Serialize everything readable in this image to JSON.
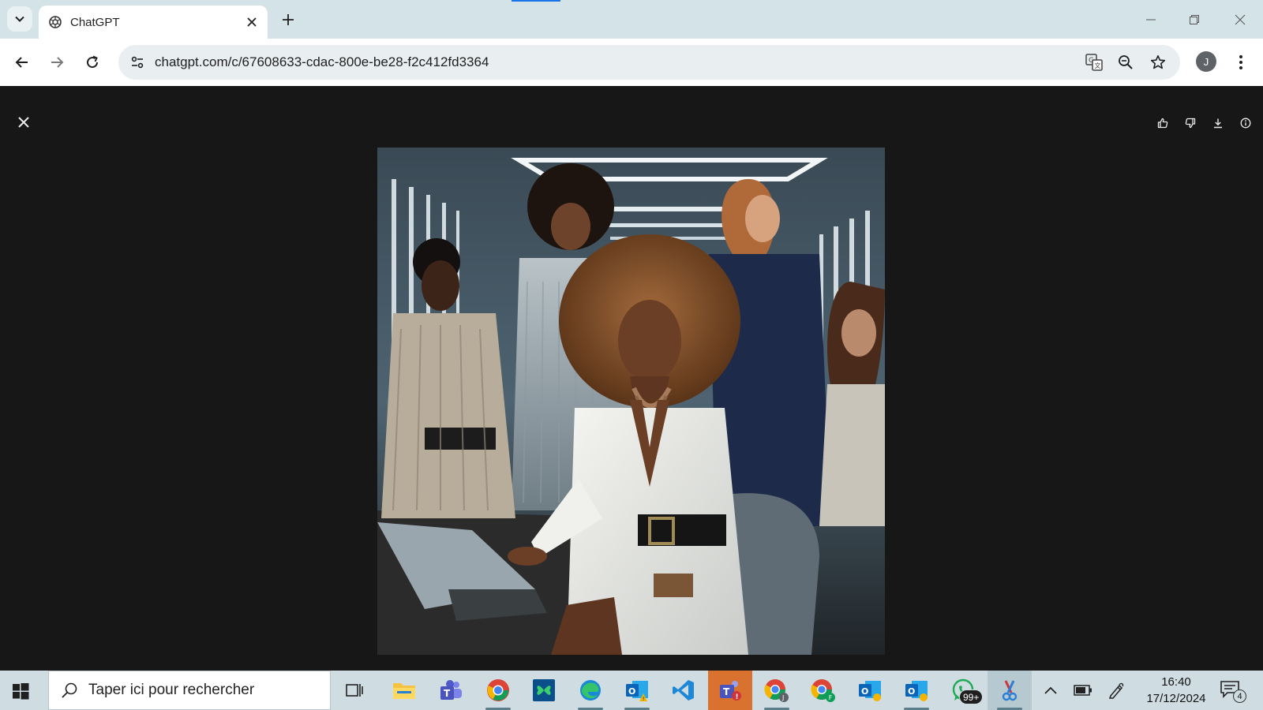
{
  "browser": {
    "tab_title": "ChatGPT",
    "url": "chatgpt.com/c/67608633-cdac-800e-be28-f2c412fd3364",
    "profile_initial": "J"
  },
  "viewer": {
    "actions": [
      "thumbs-up-icon",
      "thumbs-down-icon",
      "download-icon",
      "info-icon"
    ],
    "image_alt": "Generated image"
  },
  "taskbar": {
    "search_placeholder": "Taper ici pour rechercher",
    "whatsapp_badge": "99+",
    "time": "16:40",
    "date": "17/12/2024",
    "notification_count": "4",
    "colors": {
      "accent_active": "#d9722e",
      "background": "#cfdde3"
    }
  }
}
